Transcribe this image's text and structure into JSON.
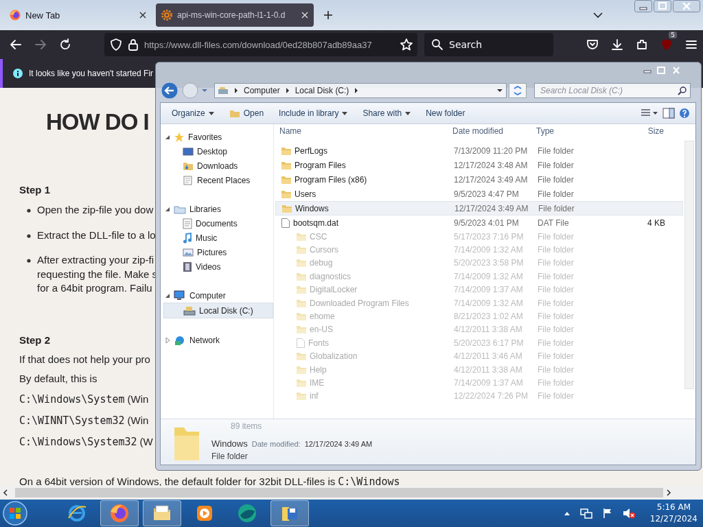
{
  "browser": {
    "tabs": [
      {
        "title": "New Tab",
        "kind": "firefox",
        "selected": false
      },
      {
        "title": "api-ms-win-core-path-l1-1-0.d",
        "kind": "gear",
        "selected": true
      }
    ],
    "url": "https://www.dll-files.com/download/0ed28b807adb89aa37",
    "search_placeholder": "Search",
    "extension_badge": "5",
    "notice": "It looks like you haven't started Fir"
  },
  "page": {
    "blocks": [
      {
        "kind": "title",
        "text": "HOW DO I"
      },
      {
        "kind": "step",
        "text": "Step 1"
      },
      {
        "kind": "bullet",
        "lines": [
          "Open the zip-file you dow"
        ]
      },
      {
        "kind": "bullet",
        "lines": [
          "Extract the DLL-file to a lo"
        ]
      },
      {
        "kind": "bullet",
        "lines": [
          "After extracting your zip-fi",
          "requesting the file. Make s",
          "for a 64bit program. Failu"
        ]
      },
      {
        "kind": "step",
        "text": "Step 2"
      },
      {
        "kind": "para",
        "text": "If that does not help your pro"
      },
      {
        "kind": "para",
        "text": "By default, this is"
      },
      {
        "kind": "path",
        "code": "C:\\Windows\\System",
        "note": "(Win"
      },
      {
        "kind": "path",
        "code": "C:\\WINNT\\System32",
        "note": "(Win"
      },
      {
        "kind": "path",
        "code": "C:\\Windows\\System32",
        "note": "(W"
      },
      {
        "kind": "note",
        "text": "On a 64bit version of Windows, the default folder for 32bit DLL-files is",
        "code": "C:\\Windows"
      }
    ]
  },
  "explorer": {
    "breadcrumb": [
      "Computer",
      "Local Disk (C:)"
    ],
    "search": {
      "placeholder": "Search Local Disk (C:)"
    },
    "toolbar": [
      {
        "label": "Organize",
        "menu": true,
        "kind": "text"
      },
      {
        "label": "Open",
        "menu": false,
        "kind": "open"
      },
      {
        "label": "Include in library",
        "menu": true,
        "kind": "text"
      },
      {
        "label": "Share with",
        "menu": true,
        "kind": "text"
      },
      {
        "label": "New folder",
        "menu": false,
        "kind": "text"
      }
    ],
    "nav": [
      {
        "label": "Favorites",
        "kind": "star",
        "expanded": true,
        "selected": false,
        "children": [
          {
            "label": "Desktop",
            "kind": "desktop",
            "selected": false
          },
          {
            "label": "Downloads",
            "kind": "downloads",
            "selected": false
          },
          {
            "label": "Recent Places",
            "kind": "recent",
            "selected": false
          }
        ]
      },
      {
        "label": "Libraries",
        "kind": "library",
        "expanded": true,
        "selected": false,
        "children": [
          {
            "label": "Documents",
            "kind": "document",
            "selected": false
          },
          {
            "label": "Music",
            "kind": "music",
            "selected": false
          },
          {
            "label": "Pictures",
            "kind": "pictures",
            "selected": false
          },
          {
            "label": "Videos",
            "kind": "videos",
            "selected": false
          }
        ]
      },
      {
        "label": "Computer",
        "kind": "computer",
        "expanded": true,
        "selected": false,
        "children": [
          {
            "label": "Local Disk (C:)",
            "kind": "disk",
            "selected": true
          }
        ]
      },
      {
        "label": "Network",
        "kind": "network",
        "expanded": false,
        "selected": false
      }
    ],
    "columns": [
      "Name",
      "Date modified",
      "Type",
      "Size"
    ],
    "rows": [
      {
        "kind": "folder",
        "name": "PerfLogs",
        "date": "7/13/2009 11:20 PM",
        "type": "File folder",
        "selected": false
      },
      {
        "kind": "folder",
        "name": "Program Files",
        "date": "12/17/2024 3:48 AM",
        "type": "File folder",
        "selected": false
      },
      {
        "kind": "folder",
        "name": "Program Files (x86)",
        "date": "12/17/2024 3:49 AM",
        "type": "File folder",
        "selected": false
      },
      {
        "kind": "folder",
        "name": "Users",
        "date": "9/5/2023 4:47 PM",
        "type": "File folder",
        "selected": false
      },
      {
        "kind": "folder",
        "name": "Windows",
        "date": "12/17/2024 3:49 AM",
        "type": "File folder",
        "selected": true
      },
      {
        "kind": "file",
        "name": "bootsqm.dat",
        "date": "9/5/2023 4:01 PM",
        "type": "DAT File",
        "size": "4 KB",
        "selected": false
      }
    ],
    "faded_rows": [
      {
        "kind": "folder",
        "name": "CSC",
        "date": "5/17/2023 7:16 PM",
        "type": "File folder"
      },
      {
        "kind": "folder",
        "name": "Cursors",
        "date": "7/14/2009 1:32 AM",
        "type": "File folder"
      },
      {
        "kind": "folder",
        "name": "debug",
        "date": "5/20/2023 3:58 PM",
        "type": "File folder"
      },
      {
        "kind": "folder",
        "name": "diagnostics",
        "date": "7/14/2009 1:32 AM",
        "type": "File folder"
      },
      {
        "kind": "folder",
        "name": "DigitalLocker",
        "date": "7/14/2009 1:37 AM",
        "type": "File folder"
      },
      {
        "kind": "folder",
        "name": "Downloaded Program Files",
        "date": "7/14/2009 1:32 AM",
        "type": "File folder"
      },
      {
        "kind": "folder",
        "name": "ehome",
        "date": "8/21/2023 1:02 AM",
        "type": "File folder"
      },
      {
        "kind": "folder",
        "name": "en-US",
        "date": "4/12/2011 3:38 AM",
        "type": "File folder"
      },
      {
        "kind": "file",
        "name": "Fonts",
        "date": "5/20/2023 6:17 PM",
        "type": "File folder"
      },
      {
        "kind": "folder",
        "name": "Globalization",
        "date": "4/12/2011 3:46 AM",
        "type": "File folder"
      },
      {
        "kind": "folder",
        "name": "Help",
        "date": "4/12/2011 3:38 AM",
        "type": "File folder"
      },
      {
        "kind": "folder",
        "name": "IME",
        "date": "7/14/2009 1:37 AM",
        "type": "File folder"
      },
      {
        "kind": "folder",
        "name": "inf",
        "date": "12/22/2024 7:26 PM",
        "type": "File folder"
      }
    ],
    "item_count": "89 items",
    "details": {
      "name": "Windows",
      "date_label": "Date modified:",
      "date": "12/17/2024 3:49 AM",
      "type": "File folder"
    }
  },
  "taskbar": {
    "apps": [
      {
        "kind": "ie",
        "running": false
      },
      {
        "kind": "firefox",
        "running": true
      },
      {
        "kind": "explorer",
        "running": true
      },
      {
        "kind": "media",
        "running": false
      },
      {
        "kind": "globe",
        "running": false
      },
      {
        "kind": "disk",
        "running": true
      }
    ],
    "time": "5:16 AM",
    "date": "12/27/2024"
  }
}
